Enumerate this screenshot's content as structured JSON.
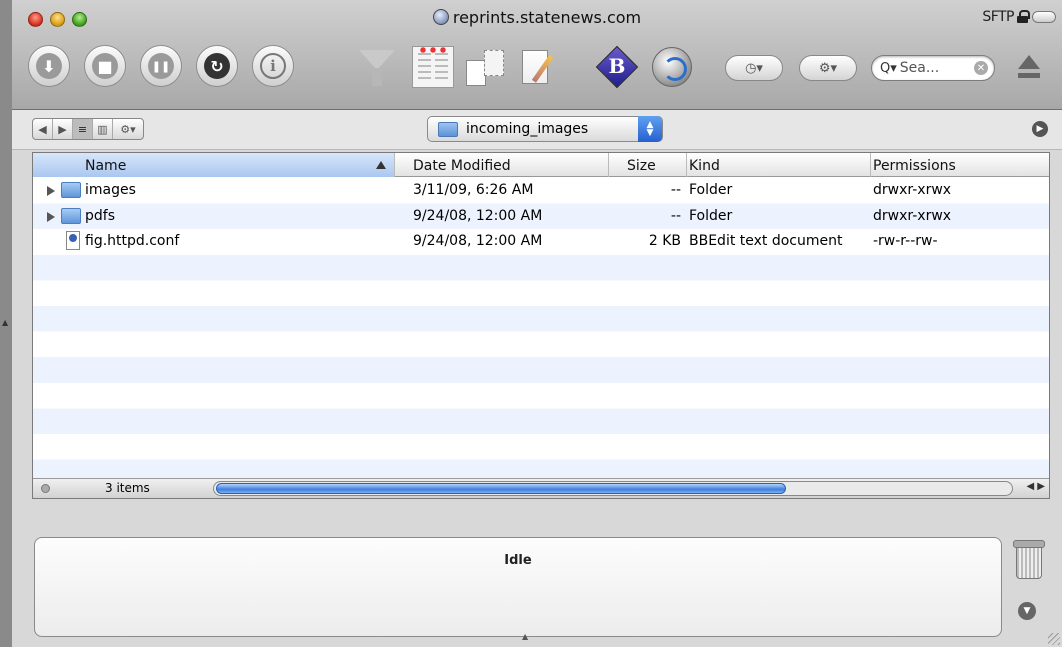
{
  "window": {
    "title": "reprints.statenews.com",
    "protocol": "SFTP"
  },
  "toolbar": {
    "buttons": [
      {
        "name": "download",
        "glyph": "⬇"
      },
      {
        "name": "stop",
        "glyph": "■"
      },
      {
        "name": "pause",
        "glyph": "❚❚"
      },
      {
        "name": "refresh",
        "glyph": "↻"
      },
      {
        "name": "info",
        "glyph": "i"
      }
    ],
    "icons": [
      "filter-icon",
      "columns-icon",
      "sync-icon",
      "edit-icon",
      "bbedit-icon",
      "globe-sync-icon"
    ],
    "bbedit_letter": "B",
    "clock_glyph": "◷▾",
    "gear_glyph": "⚙▾",
    "search_prefix": "Q▾",
    "search_placeholder": "Sea...",
    "search_clear": "✕"
  },
  "path": {
    "folder": "incoming_images"
  },
  "viewseg": [
    "◀",
    "▶",
    "≡",
    "▥",
    "⚙▾"
  ],
  "table": {
    "columns": [
      "Name",
      "Date Modified",
      "Size",
      "Kind",
      "Permissions"
    ],
    "rows": [
      {
        "type": "folder",
        "name": "images",
        "date": "3/11/09, 6:26 AM",
        "size": "--",
        "kind": "Folder",
        "perm": "drwxr-xrwx"
      },
      {
        "type": "folder",
        "name": "pdfs",
        "date": "9/24/08, 12:00 AM",
        "size": "--",
        "kind": "Folder",
        "perm": "drwxr-xrwx"
      },
      {
        "type": "file",
        "name": "fig.httpd.conf",
        "date": "9/24/08, 12:00 AM",
        "size": "2 KB",
        "kind": "BBEdit text document",
        "perm": "-rw-r--rw-"
      }
    ]
  },
  "status": {
    "item_count": "3 items"
  },
  "transfer": {
    "state": "Idle"
  }
}
